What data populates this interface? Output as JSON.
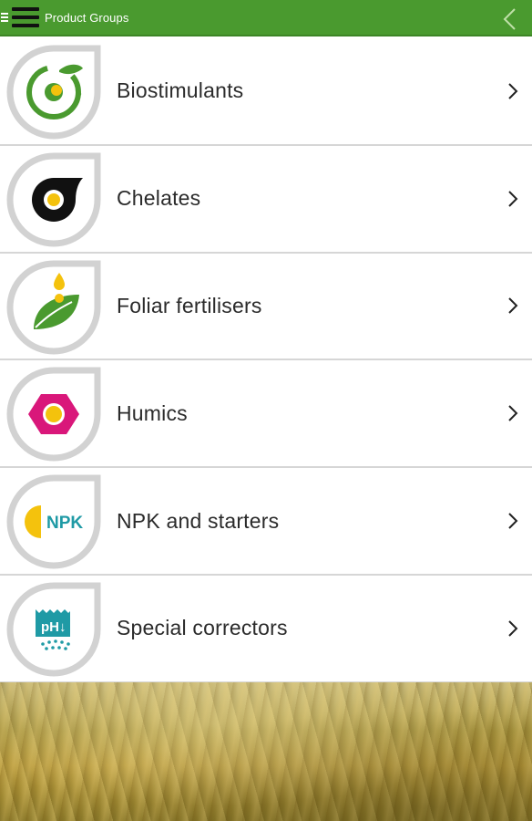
{
  "app_bar": {
    "title": "Product Groups",
    "color": "#4a9a2f",
    "menu_icon": "hamburger-icon",
    "back_icon": "chevron-left-icon"
  },
  "product_groups": [
    {
      "label": "Biostimulants",
      "icon": "biostimulants-icon",
      "accent": "#4a9a2f"
    },
    {
      "label": "Chelates",
      "icon": "chelates-icon",
      "accent": "#111111"
    },
    {
      "label": "Foliar fertilisers",
      "icon": "foliar-fertilisers-icon",
      "accent": "#4a9a2f"
    },
    {
      "label": "Humics",
      "icon": "humics-icon",
      "accent": "#d9177a"
    },
    {
      "label": "NPK and starters",
      "icon": "npk-icon",
      "accent": "#1f9aa5",
      "icon_text": "NPK"
    },
    {
      "label": "Special correctors",
      "icon": "special-correctors-icon",
      "accent": "#1f9aa5",
      "icon_text": "pH↓"
    }
  ],
  "row_chevron_icon": "chevron-right-icon",
  "footer": {
    "image": "wheat-field-photo"
  }
}
